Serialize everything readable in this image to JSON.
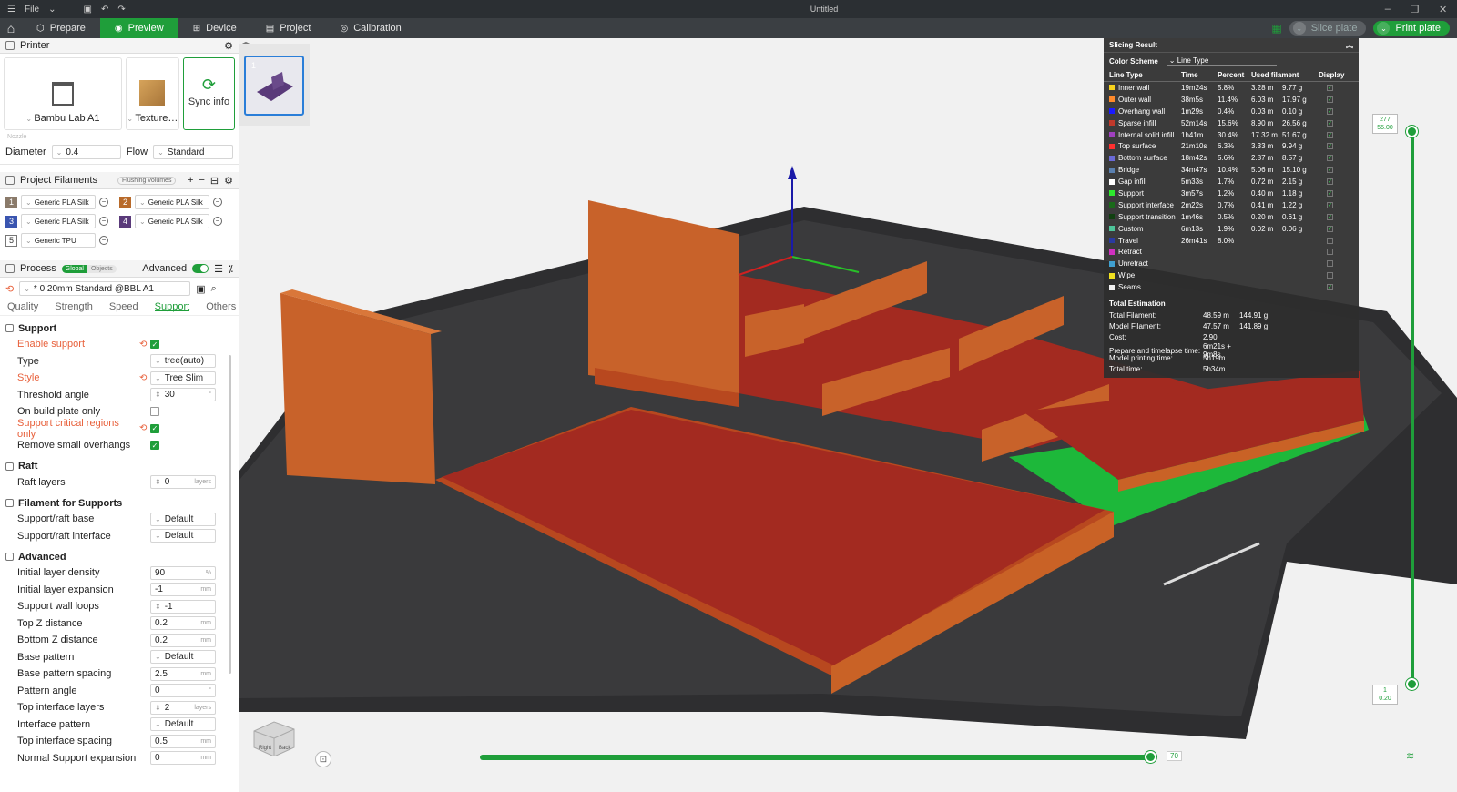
{
  "titlebar": {
    "file_label": "File",
    "title": "Untitled"
  },
  "topbar": {
    "tabs": [
      {
        "label": "Prepare",
        "icon": "cube-icon"
      },
      {
        "label": "Preview",
        "icon": "layers-icon"
      },
      {
        "label": "Device",
        "icon": "device-icon"
      },
      {
        "label": "Project",
        "icon": "project-icon"
      },
      {
        "label": "Calibration",
        "icon": "calibration-icon"
      }
    ],
    "active_tab": "Preview",
    "slice_label": "Slice plate",
    "print_label": "Print plate",
    "accent_color": "#1f9e3a"
  },
  "printer": {
    "header": "Printer",
    "printer_name": "Bambu Lab A1",
    "plate_name": "Texture…",
    "sync_label": "Sync info",
    "nozzle_label": "Nozzle",
    "diameter_label": "Diameter",
    "diameter_value": "0.4",
    "flow_label": "Flow",
    "flow_value": "Standard"
  },
  "filaments": {
    "header": "Project Filaments",
    "flush_label": "Flushing volumes",
    "items": [
      {
        "num": "1",
        "name": "Generic PLA Silk",
        "color": "#8a7a6a"
      },
      {
        "num": "2",
        "name": "Generic PLA Silk",
        "color": "#b86a2a"
      },
      {
        "num": "3",
        "name": "Generic PLA Silk",
        "color": "#3a55b0"
      },
      {
        "num": "4",
        "name": "Generic PLA Silk",
        "color": "#5a3a7a"
      },
      {
        "num": "5",
        "name": "Generic TPU",
        "color": "#ffffff"
      }
    ]
  },
  "process": {
    "header": "Process",
    "global_label": "Global",
    "objects_label": "Objects",
    "advanced_label": "Advanced",
    "preset": "* 0.20mm Standard @BBL A1",
    "tabs": [
      "Quality",
      "Strength",
      "Speed",
      "Support",
      "Others"
    ],
    "active_tab": "Support"
  },
  "support": {
    "header": "Support",
    "enable_label": "Enable support",
    "type_label": "Type",
    "type_value": "tree(auto)",
    "style_label": "Style",
    "style_value": "Tree Slim",
    "threshold_label": "Threshold angle",
    "threshold_value": "30",
    "threshold_unit": "°",
    "buildplate_label": "On build plate only",
    "critical_label": "Support critical regions only",
    "remove_label": "Remove small overhangs"
  },
  "raft": {
    "header": "Raft",
    "layers_label": "Raft layers",
    "layers_value": "0",
    "layers_unit": "layers"
  },
  "filament_supports": {
    "header": "Filament for Supports",
    "base_label": "Support/raft base",
    "base_value": "Default",
    "interface_label": "Support/raft interface",
    "interface_value": "Default"
  },
  "advanced": {
    "header": "Advanced",
    "rows": [
      {
        "label": "Initial layer density",
        "value": "90",
        "unit": "%",
        "kind": "input"
      },
      {
        "label": "Initial layer expansion",
        "value": "-1",
        "unit": "mm",
        "kind": "input"
      },
      {
        "label": "Support wall loops",
        "value": "-1",
        "unit": "",
        "kind": "spin"
      },
      {
        "label": "Top Z distance",
        "value": "0.2",
        "unit": "mm",
        "kind": "input"
      },
      {
        "label": "Bottom Z distance",
        "value": "0.2",
        "unit": "mm",
        "kind": "input"
      },
      {
        "label": "Base pattern",
        "value": "Default",
        "unit": "",
        "kind": "select"
      },
      {
        "label": "Base pattern spacing",
        "value": "2.5",
        "unit": "mm",
        "kind": "input"
      },
      {
        "label": "Pattern angle",
        "value": "0",
        "unit": "°",
        "kind": "input"
      },
      {
        "label": "Top interface layers",
        "value": "2",
        "unit": "layers",
        "kind": "spin"
      },
      {
        "label": "Interface pattern",
        "value": "Default",
        "unit": "",
        "kind": "select"
      },
      {
        "label": "Top interface spacing",
        "value": "0.5",
        "unit": "mm",
        "kind": "input"
      },
      {
        "label": "Normal Support expansion",
        "value": "0",
        "unit": "mm",
        "kind": "input"
      }
    ]
  },
  "plate_thumb": {
    "number": "1"
  },
  "slicing": {
    "header": "Slicing Result",
    "color_scheme_label": "Color Scheme",
    "color_scheme_value": "Line Type",
    "columns": [
      "Line Type",
      "Time",
      "Percent",
      "Used filament",
      "",
      "Display"
    ],
    "rows": [
      {
        "name": "Inner wall",
        "color": "#f7d21c",
        "time": "19m24s",
        "percent": "5.8%",
        "len": "3.28 m",
        "g": "9.77 g",
        "disp": "✓"
      },
      {
        "name": "Outer wall",
        "color": "#ff8a2b",
        "time": "38m5s",
        "percent": "11.4%",
        "len": "6.03 m",
        "g": "17.97 g",
        "disp": "✓"
      },
      {
        "name": "Overhang wall",
        "color": "#1a1aff",
        "time": "1m29s",
        "percent": "0.4%",
        "len": "0.03 m",
        "g": "0.10 g",
        "disp": "✓"
      },
      {
        "name": "Sparse infill",
        "color": "#c0392b",
        "time": "52m14s",
        "percent": "15.6%",
        "len": "8.90 m",
        "g": "26.56 g",
        "disp": "✓"
      },
      {
        "name": "Internal solid infill",
        "color": "#a040c0",
        "time": "1h41m",
        "percent": "30.4%",
        "len": "17.32 m",
        "g": "51.67 g",
        "disp": "✓"
      },
      {
        "name": "Top surface",
        "color": "#ff3030",
        "time": "21m10s",
        "percent": "6.3%",
        "len": "3.33 m",
        "g": "9.94 g",
        "disp": "✓"
      },
      {
        "name": "Bottom surface",
        "color": "#6a6ad8",
        "time": "18m42s",
        "percent": "5.6%",
        "len": "2.87 m",
        "g": "8.57 g",
        "disp": "✓"
      },
      {
        "name": "Bridge",
        "color": "#5a80b0",
        "time": "34m47s",
        "percent": "10.4%",
        "len": "5.06 m",
        "g": "15.10 g",
        "disp": "✓"
      },
      {
        "name": "Gap infill",
        "color": "#ffffff",
        "time": "5m33s",
        "percent": "1.7%",
        "len": "0.72 m",
        "g": "2.15 g",
        "disp": "✓"
      },
      {
        "name": "Support",
        "color": "#2ee82e",
        "time": "3m57s",
        "percent": "1.2%",
        "len": "0.40 m",
        "g": "1.18 g",
        "disp": "✓"
      },
      {
        "name": "Support interface",
        "color": "#1a6a1a",
        "time": "2m22s",
        "percent": "0.7%",
        "len": "0.41 m",
        "g": "1.22 g",
        "disp": "✓"
      },
      {
        "name": "Support transition",
        "color": "#104010",
        "time": "1m46s",
        "percent": "0.5%",
        "len": "0.20 m",
        "g": "0.61 g",
        "disp": "✓"
      },
      {
        "name": "Custom",
        "color": "#4ec59a",
        "time": "6m13s",
        "percent": "1.9%",
        "len": "0.02 m",
        "g": "0.06 g",
        "disp": "✓"
      },
      {
        "name": "Travel",
        "color": "#2a3aa0",
        "time": "26m41s",
        "percent": "8.0%",
        "len": "",
        "g": "",
        "disp": ""
      },
      {
        "name": "Retract",
        "color": "#d030c0",
        "time": "",
        "percent": "",
        "len": "",
        "g": "",
        "disp": ""
      },
      {
        "name": "Unretract",
        "color": "#40a0d0",
        "time": "",
        "percent": "",
        "len": "",
        "g": "",
        "disp": ""
      },
      {
        "name": "Wipe",
        "color": "#f0e020",
        "time": "",
        "percent": "",
        "len": "",
        "g": "",
        "disp": ""
      },
      {
        "name": "Seams",
        "color": "#f0f0f0",
        "time": "",
        "percent": "",
        "len": "",
        "g": "",
        "disp": "✓"
      }
    ],
    "estimation_header": "Total Estimation",
    "estimation": [
      {
        "label": "Total Filament:",
        "a": "48.59 m",
        "b": "144.91 g"
      },
      {
        "label": "Model Filament:",
        "a": "47.57 m",
        "b": "141.89 g"
      },
      {
        "label": "Cost:",
        "a": "2.90",
        "b": ""
      },
      {
        "label": "Prepare and timelapse time:",
        "a": "6m21s + 9m8s",
        "b": ""
      },
      {
        "label": "Model printing time:",
        "a": "5h19m",
        "b": ""
      },
      {
        "label": "Total time:",
        "a": "5h34m",
        "b": ""
      }
    ]
  },
  "layer_slider": {
    "top_layer": "277",
    "top_height": "55.00",
    "bottom_layer": "1",
    "bottom_height": "0.20"
  },
  "move_slider": {
    "value": "70"
  },
  "navcube": {
    "right_label": "Right",
    "back_label": "Back"
  }
}
